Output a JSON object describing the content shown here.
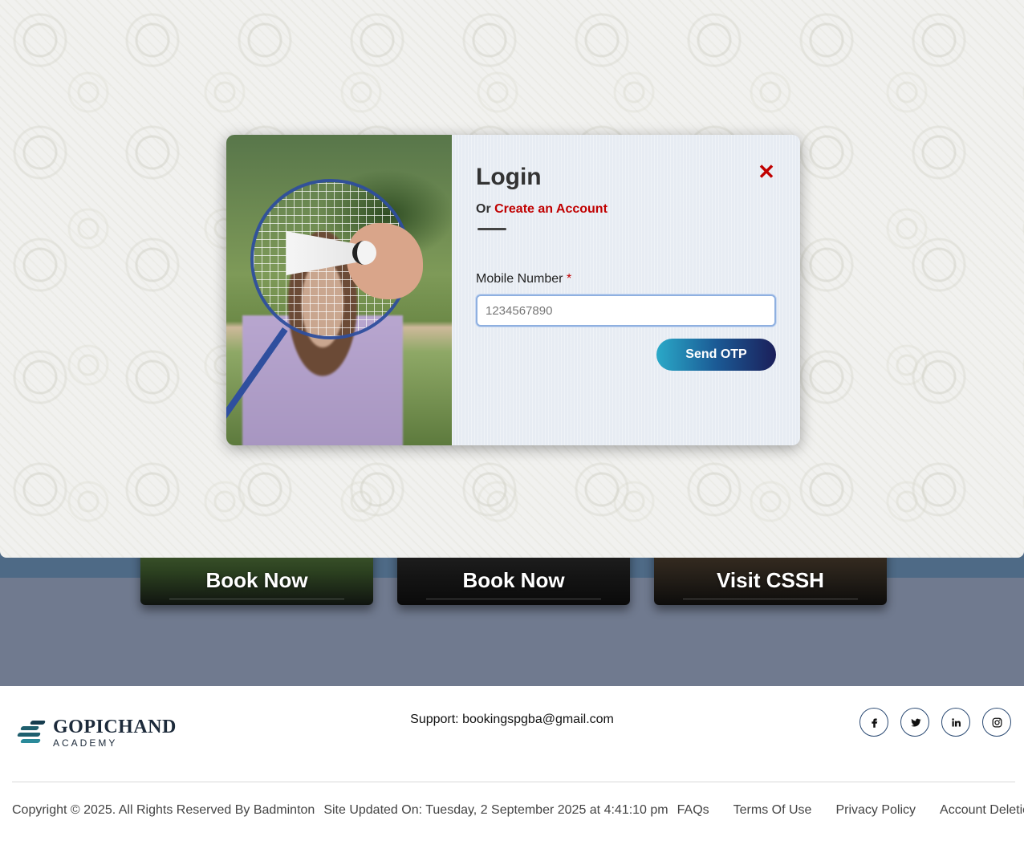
{
  "background_cards": [
    {
      "label": "Book Now"
    },
    {
      "label": "Book Now"
    },
    {
      "label": "Visit CSSH"
    }
  ],
  "login_modal": {
    "title": "Login",
    "or_text": "Or",
    "create_account_link": "Create an Account",
    "close_icon": "close-icon",
    "mobile_label": "Mobile Number",
    "required_mark": "*",
    "mobile_placeholder": "1234567890",
    "mobile_value": "",
    "send_button": "Send OTP"
  },
  "footer": {
    "logo_name": "GOPICHAND",
    "logo_sub": "ACADEMY",
    "support": "Support: bookingspgba@gmail.com",
    "socials": [
      {
        "name": "facebook-icon",
        "glyph": "f"
      },
      {
        "name": "twitter-icon",
        "glyph": "t"
      },
      {
        "name": "linkedin-icon",
        "glyph": "in"
      },
      {
        "name": "instagram-icon",
        "glyph": "ig"
      }
    ],
    "copyright": "Copyright © 2025. All Rights Reserved By Badminton",
    "updated": "Site Updated On: Tuesday, 2 September 2025 at 4:41:10 pm",
    "links": {
      "faqs": "FAQs",
      "terms": "Terms Of Use",
      "privacy": "Privacy Policy",
      "account_deletion": "Account Deletion"
    }
  },
  "colors": {
    "accent_red": "#c00000",
    "button_gradient_start": "#2aa9c8",
    "button_gradient_end": "#1b1f5a",
    "band_gray": "#707a8f"
  }
}
